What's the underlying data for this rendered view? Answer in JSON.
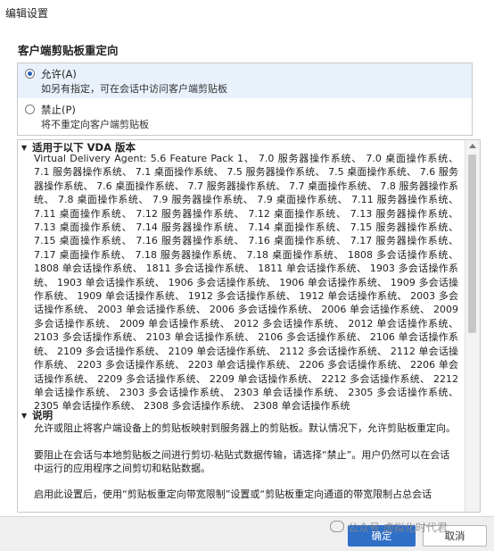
{
  "window": {
    "title": "编辑设置"
  },
  "setting": {
    "title": "客户端剪贴板重定向"
  },
  "options": [
    {
      "label": "允许(A)",
      "description": "如另有指定，可在会话中访问客户端剪贴板",
      "selected": true
    },
    {
      "label": "禁止(P)",
      "description": "将不重定向客户端剪贴板",
      "selected": false
    }
  ],
  "vda": {
    "heading": "适用于以下 VDA 版本",
    "text": "Virtual Delivery Agent: 5.6 Feature Pack 1、 7.0 服务器操作系统、 7.0 桌面操作系统、 7.1 服务器操作系统、 7.1 桌面操作系统、 7.5 服务器操作系统、 7.5 桌面操作系统、 7.6 服务器操作系统、 7.6 桌面操作系统、 7.7 服务器操作系统、 7.7 桌面操作系统、 7.8 服务器操作系统、 7.8 桌面操作系统、 7.9 服务器操作系统、 7.9 桌面操作系统、 7.11 服务器操作系统、 7.11 桌面操作系统、 7.12 服务器操作系统、 7.12 桌面操作系统、 7.13 服务器操作系统、 7.13 桌面操作系统、 7.14 服务器操作系统、 7.14 桌面操作系统、 7.15 服务器操作系统、 7.15 桌面操作系统、 7.16 服务器操作系统、 7.16 桌面操作系统、 7.17 服务器操作系统、 7.17 桌面操作系统、 7.18 服务器操作系统、 7.18 桌面操作系统、 1808 多会话操作系统、 1808 单会话操作系统、 1811 多会话操作系统、 1811 单会话操作系统、 1903 多会话操作系统、 1903 单会话操作系统、 1906 多会话操作系统、 1906 单会话操作系统、 1909 多会话操作系统、 1909 单会话操作系统、 1912 多会话操作系统、 1912 单会话操作系统、 2003 多会话操作系统、 2003 单会话操作系统、 2006 多会话操作系统、 2006 单会话操作系统、 2009 多会话操作系统、 2009 单会话操作系统、 2012 多会话操作系统、 2012 单会话操作系统、 2103 多会话操作系统、 2103 单会话操作系统、 2106 多会话操作系统、 2106 单会话操作系统、 2109 多会话操作系统、 2109 单会话操作系统、 2112 多会话操作系统、 2112 单会话操作系统、 2203 多会话操作系统、 2203 单会话操作系统、 2206 多会话操作系统、 2206 单会话操作系统、 2209 多会话操作系统、 2209 单会话操作系统、 2212 多会话操作系统、 2212 单会话操作系统、 2303 多会话操作系统、 2303 单会话操作系统、 2305 多会话操作系统、 2305 单会话操作系统、 2308 多会话操作系统、 2308 单会话操作系统"
  },
  "description": {
    "heading": "说明",
    "p1": "允许或阻止将客户端设备上的剪贴板映射到服务器上的剪贴板。默认情况下，允许剪贴板重定向。",
    "p2": "要阻止在会话与本地剪贴板之间进行剪切-粘贴式数据传输，请选择“禁止”。用户仍然可以在会话中运行的应用程序之间剪切和粘贴数据。",
    "p3": "启用此设置后，使用“剪贴板重定向带宽限制”设置或“剪贴板重定向通道的带宽限制占总会话"
  },
  "buttons": {
    "ok": "确定",
    "cancel": "取消"
  },
  "watermark": "公众号·虚拟化时代君",
  "colors": {
    "accent": "#2f6fc7",
    "selected_bg": "#e9f1fb"
  }
}
